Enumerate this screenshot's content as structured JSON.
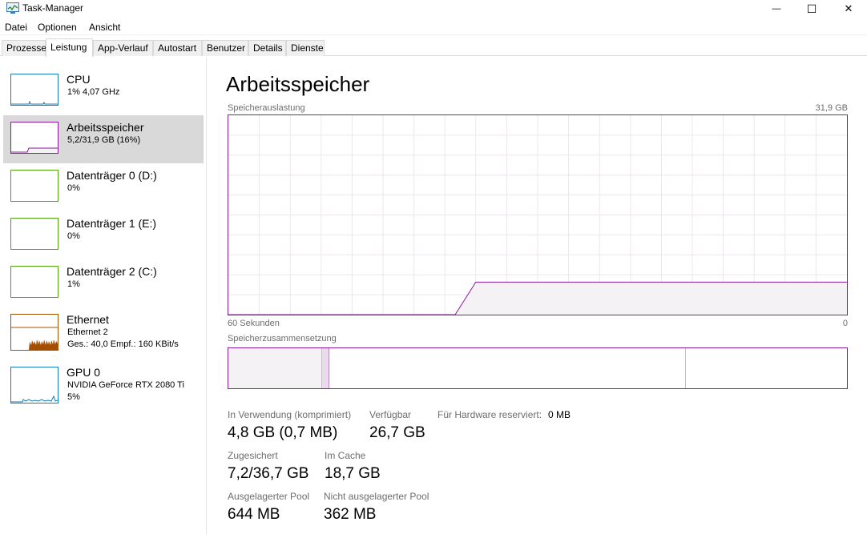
{
  "window": {
    "title": "Task-Manager",
    "minimize_glyph": "—",
    "maximize_glyph": "☐",
    "close_glyph": "✕"
  },
  "menu": [
    "Datei",
    "Optionen",
    "Ansicht"
  ],
  "tabs": [
    "Prozesse",
    "Leistung",
    "App-Verlauf",
    "Autostart",
    "Benutzer",
    "Details",
    "Dienste"
  ],
  "active_tab": "Leistung",
  "sidebar": {
    "items": [
      {
        "title": "CPU",
        "sub1": "1% 4,07 GHz",
        "sub2": "",
        "color": "#117dbb"
      },
      {
        "title": "Arbeitsspeicher",
        "sub1": "5,2/31,9 GB (16%)",
        "sub2": "",
        "color": "#8b1a9e"
      },
      {
        "title": "Datenträger 0 (D:)",
        "sub1": "0%",
        "sub2": "",
        "color": "#4da60c"
      },
      {
        "title": "Datenträger 1 (E:)",
        "sub1": "0%",
        "sub2": "",
        "color": "#4da60c"
      },
      {
        "title": "Datenträger 2 (C:)",
        "sub1": "1%",
        "sub2": "",
        "color": "#4da60c"
      },
      {
        "title": "Ethernet",
        "sub1": "Ethernet 2",
        "sub2": "Ges.: 40,0  Empf.: 160 KBit/s",
        "color": "#a74f01"
      },
      {
        "title": "GPU 0",
        "sub1": "NVIDIA GeForce RTX 2080 Ti",
        "sub2": "5%",
        "color": "#117dbb"
      }
    ],
    "selected": 1
  },
  "main": {
    "title": "Arbeitsspeicher",
    "usage_label": "Speicherauslastung",
    "usage_max": "31,9 GB",
    "time_label_left": "60 Sekunden",
    "time_label_right": "0",
    "composition_label": "Speicherzusammensetzung",
    "accent": "#8b1a9e",
    "stats": {
      "in_use_label": "In Verwendung (komprimiert)",
      "in_use_value": "4,8 GB (0,7 MB)",
      "available_label": "Verfügbar",
      "available_value": "26,7 GB",
      "hw_reserved_label": "Für Hardware reserviert:",
      "hw_reserved_value": "0 MB",
      "committed_label": "Zugesichert",
      "committed_value": "7,2/36,7 GB",
      "cached_label": "Im Cache",
      "cached_value": "18,7 GB",
      "paged_label": "Ausgelagerter Pool",
      "paged_value": "644 MB",
      "nonpaged_label": "Nicht ausgelagerter Pool",
      "nonpaged_value": "362 MB"
    }
  },
  "chart_data": {
    "type": "area",
    "title": "Speicherauslastung",
    "xlabel": "",
    "ylabel": "",
    "x": [
      60,
      38,
      36,
      34,
      0
    ],
    "x_range": [
      60,
      0
    ],
    "series": [
      {
        "values": [
          0,
          0,
          5.2,
          5.2,
          5.2
        ]
      }
    ],
    "ylim": [
      0,
      31.9
    ],
    "grid": true
  }
}
